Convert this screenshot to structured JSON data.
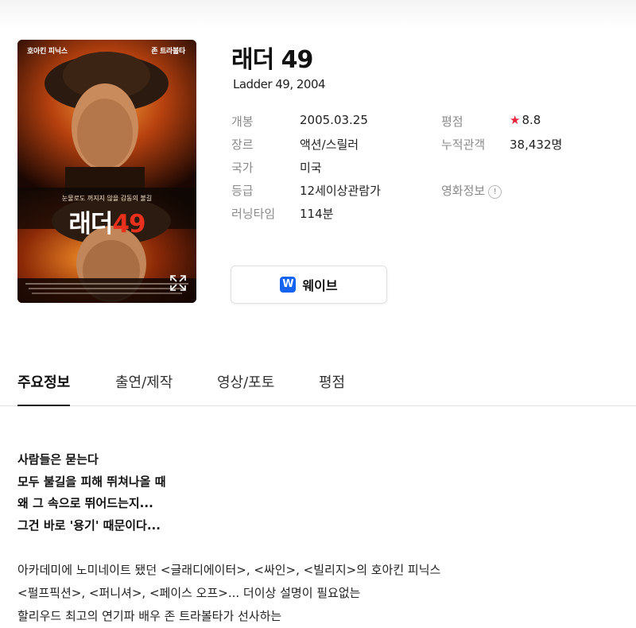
{
  "movie": {
    "title": "래더 49",
    "original_title_year": "Ladder 49, 2004"
  },
  "poster": {
    "actor_left": "호아킨 피닉스",
    "actor_right": "존 트라볼타",
    "tagline": "눈물로도 꺼지지 않을 감동의 불길",
    "title_part1": "래더",
    "title_part2": "49",
    "expand_icon": "expand-icon"
  },
  "info_left": [
    {
      "label": "개봉",
      "value": "2005.03.25"
    },
    {
      "label": "장르",
      "value": "액션/스릴러"
    },
    {
      "label": "국가",
      "value": "미국"
    },
    {
      "label": "등급",
      "value": "12세이상관람가"
    },
    {
      "label": "러닝타임",
      "value": "114분"
    }
  ],
  "info_right": {
    "rating_label": "평점",
    "rating_icon": "star-icon",
    "rating_value": "8.8",
    "audience_label": "누적관객",
    "audience_value": "38,432명",
    "movie_info_label": "영화정보"
  },
  "watch_button": {
    "logo": "W",
    "label": "웨이브"
  },
  "tabs": [
    {
      "label": "주요정보",
      "active": true
    },
    {
      "label": "출연/제작",
      "active": false
    },
    {
      "label": "영상/포토",
      "active": false
    },
    {
      "label": "평점",
      "active": false
    }
  ],
  "synopsis": {
    "headline": [
      "사람들은 묻는다",
      "모두 불길을 피해 뛰쳐나올 때",
      "왜 그 속으로 뛰어드는지...",
      "그건 바로 '용기' 때문이다..."
    ],
    "body": [
      "아카데미에 노미네이트 됐던 <글래디에이터>, <싸인>, <빌리지>의 호아킨 피닉스",
      "<펄프픽션>, <퍼니셔>, <페이스 오프>... 더이상 설명이 필요없는",
      "할리우드 최고의 연기파 배우 존 트라볼타가 선사하는"
    ]
  },
  "colors": {
    "accent_star": "#e8243c",
    "wavve_blue": "#1463f2"
  }
}
